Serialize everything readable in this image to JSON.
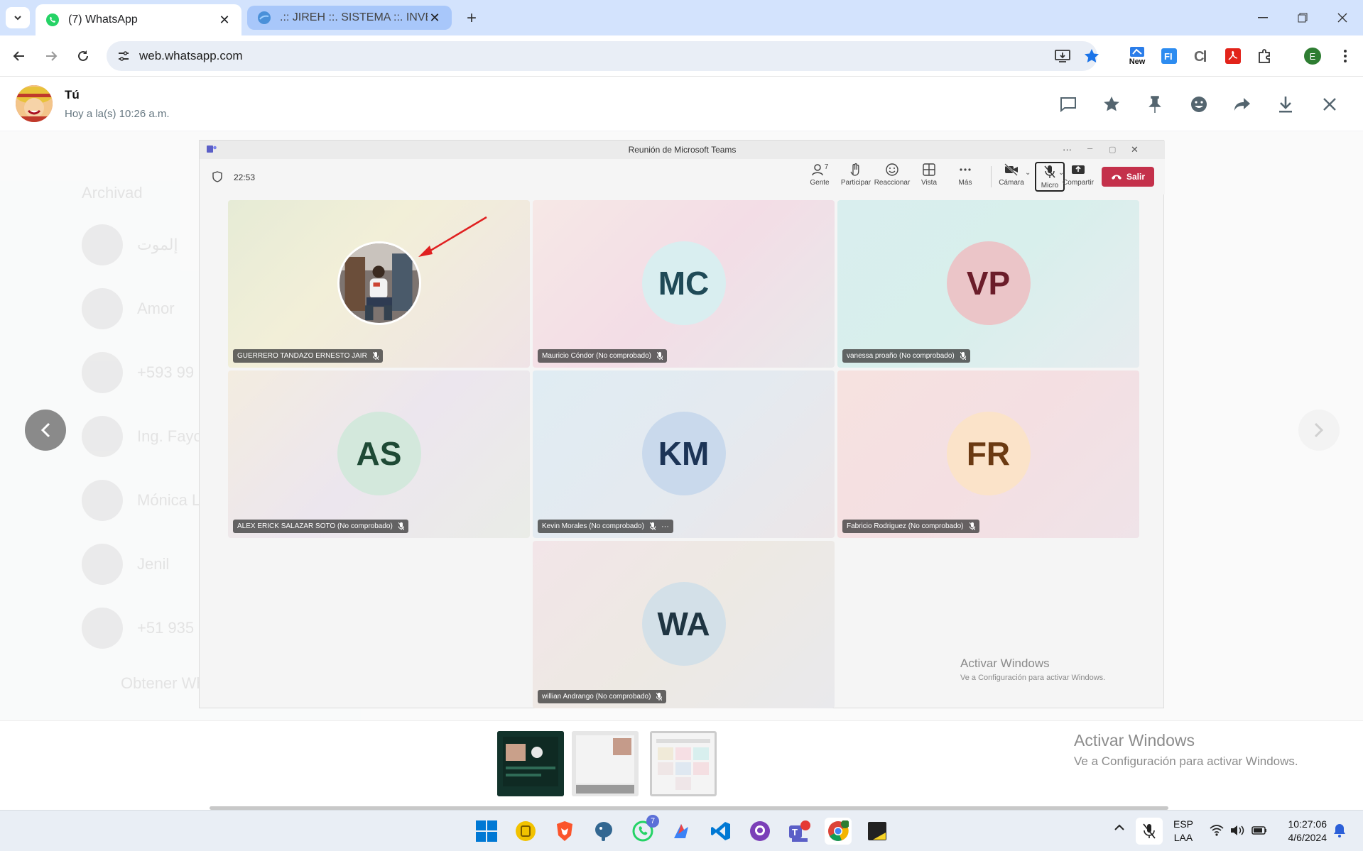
{
  "browser": {
    "tabs": [
      {
        "title": "(7) WhatsApp",
        "active": true
      },
      {
        "title": ".:: JIREH ::. SISTEMA ::. INVERSIO",
        "active": false
      }
    ],
    "url": "web.whatsapp.com",
    "profile_initial": "E",
    "new_badge": "New"
  },
  "viewer": {
    "sender": "Tú",
    "time": "Hoy a la(s) 10:26 a.m."
  },
  "background_chats": [
    "Archivad",
    "إلموت",
    "Amor",
    "+593 99",
    "Ing. Fayo",
    "Mónica L",
    "Jenil",
    "+51 935"
  ],
  "get_app_banner": "Obtener WhatsApp para Windows",
  "teams": {
    "window_title": "Reunión de Microsoft Teams",
    "timer": "22:53",
    "tools": [
      {
        "label": "Gente",
        "count": "7",
        "icon": "people-icon"
      },
      {
        "label": "Participar",
        "icon": "hand-icon"
      },
      {
        "label": "Reaccionar",
        "icon": "smile-icon"
      },
      {
        "label": "Vista",
        "icon": "grid-icon"
      },
      {
        "label": "Más",
        "icon": "more-icon"
      },
      {
        "label": "Cámara",
        "icon": "camera-off-icon"
      },
      {
        "label": "Micro",
        "icon": "mic-off-icon"
      },
      {
        "label": "Compartir",
        "icon": "share-icon"
      }
    ],
    "leave_label": "Salir",
    "participants": [
      {
        "initials": "",
        "name": "GUERRERO TANDAZO ERNESTO JAIR",
        "photo": true
      },
      {
        "initials": "MC",
        "name": "Mauricio Cóndor (No comprobado)"
      },
      {
        "initials": "VP",
        "name": "vanessa proaño (No comprobado)"
      },
      {
        "initials": "AS",
        "name": "ALEX ERICK SALAZAR SOTO (No comprobado)"
      },
      {
        "initials": "KM",
        "name": "Kevin Morales (No comprobado)"
      },
      {
        "initials": "FR",
        "name": "Fabricio Rodriguez (No comprobado)"
      },
      {
        "initials": "WA",
        "name": "willian Andrango (No comprobado)"
      }
    ],
    "activation_title": "Activar Windows",
    "activation_sub": "Ve a Configuración para activar Windows."
  },
  "activation_title": "Activar Windows",
  "activation_sub": "Ve a Configuración para activar Windows.",
  "taskbar": {
    "whatsapp_badge": "7",
    "lang": "ESP",
    "lang_sub": "LAA",
    "time": "10:27:06",
    "date": "4/6/2024"
  }
}
